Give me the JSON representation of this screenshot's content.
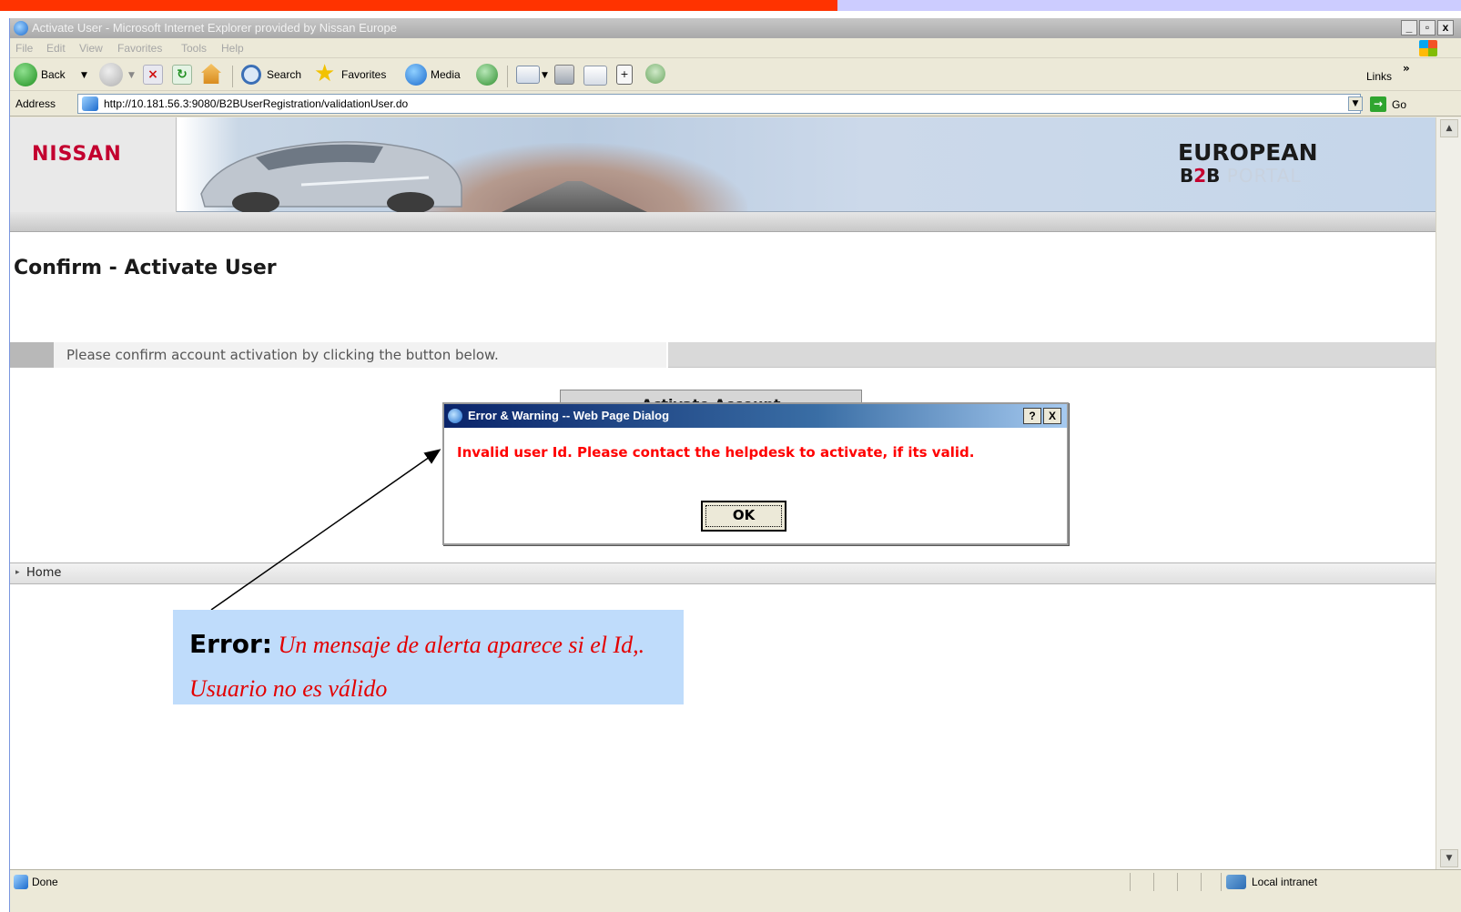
{
  "window": {
    "title": "Activate User - Microsoft Internet Explorer provided by Nissan Europe",
    "controls": [
      "_",
      "Ʌ",
      "X"
    ]
  },
  "menu": [
    "File",
    "Edit",
    "View",
    "Favorites",
    "Tools",
    "Help"
  ],
  "toolbar": {
    "back_label": "Back",
    "search_label": "Search",
    "favorites_label": "Favorites",
    "media_label": "Media",
    "links_label": "Links",
    "overflow": "»"
  },
  "address": {
    "label": "Address",
    "url": "http://10.181.56.3:9080/B2BUserRegistration/validationUser.do",
    "go_label": "Go"
  },
  "banner": {
    "brand": "NISSAN",
    "portal_line1": "EUROPEAN",
    "portal_b": "B",
    "portal_2": "2",
    "portal_b2": "B",
    "portal_text": " PORTAL"
  },
  "page": {
    "title": "Confirm - Activate User",
    "instruction": "Please confirm account activation by clicking the button below.",
    "activate_button": "Activate Account",
    "home_link": "Home",
    "home_arrow": "▸"
  },
  "dialog": {
    "title": "Error & Warning -- Web Page Dialog",
    "help_btn": "?",
    "close_btn": "X",
    "message": "Invalid user Id. Please contact the helpdesk to activate, if its valid.",
    "ok_label": "OK"
  },
  "annotation": {
    "label": "Error:",
    "text": "Un mensaje de alerta aparece si el Id,. Usuario no es válido"
  },
  "status": {
    "text": "Done",
    "zone": "Local intranet"
  },
  "colors": {
    "error_red": "#ff0000",
    "nissan_red": "#c3002f",
    "annotation_bg": "#bfdcfb",
    "dialog_title_blue": "#0a246a"
  }
}
